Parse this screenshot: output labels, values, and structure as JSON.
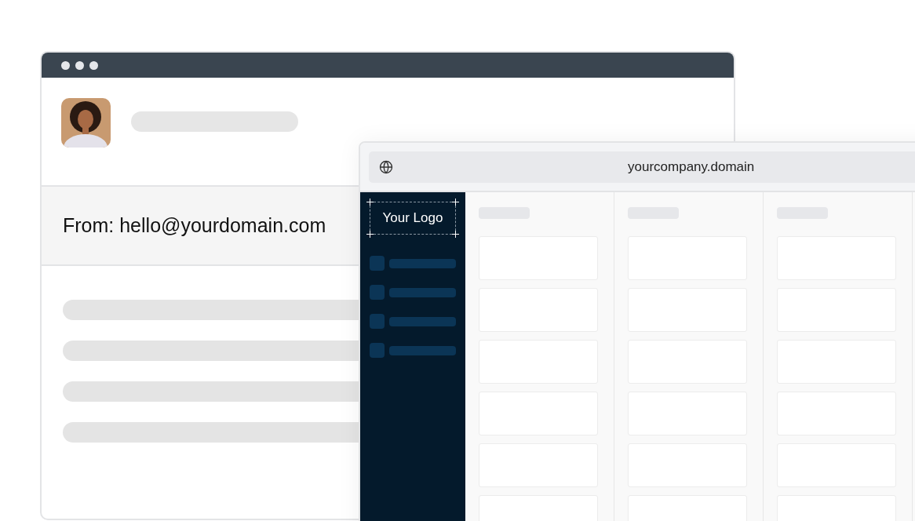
{
  "email_window": {
    "from_line": "From: hello@yourdomain.com"
  },
  "browser_window": {
    "url": "yourcompany.domain",
    "logo": "Your Logo"
  }
}
